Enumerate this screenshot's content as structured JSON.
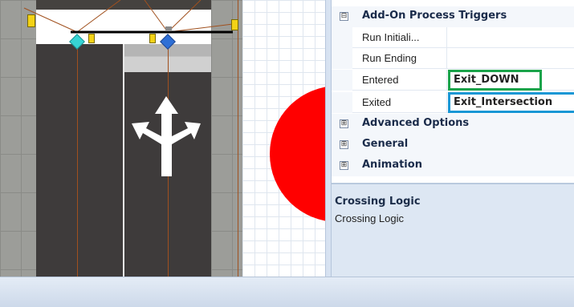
{
  "properties": {
    "categories": [
      {
        "label": "Add-On Process Triggers",
        "expander": "⊟",
        "expanded": true,
        "rows": [
          {
            "name": "Run Initiali...",
            "value": ""
          },
          {
            "name": "Run Ending",
            "value": ""
          },
          {
            "name": "Entered",
            "value": "Exit_DOWN",
            "highlight": "#1aa34a"
          },
          {
            "name": "Exited",
            "value": "Exit_Intersection",
            "highlight": "#1997d5"
          }
        ]
      },
      {
        "label": "Advanced Options",
        "expander": "⊞",
        "expanded": false
      },
      {
        "label": "General",
        "expander": "⊞",
        "expanded": false
      },
      {
        "label": "Animation",
        "expander": "⊞",
        "expanded": false
      }
    ]
  },
  "description": {
    "title": "Crossing Logic",
    "text": "Crossing Logic"
  },
  "scene": {
    "icons": [
      "straight-left-right-arrow-icon",
      "cyan-node-icon",
      "blue-node-icon",
      "yellow-tag-icon"
    ],
    "colors": {
      "road": "#3e3b3b",
      "sidewalk": "#9c9d99",
      "circle": "#ff0000",
      "lane_line": "#a0501e"
    }
  }
}
